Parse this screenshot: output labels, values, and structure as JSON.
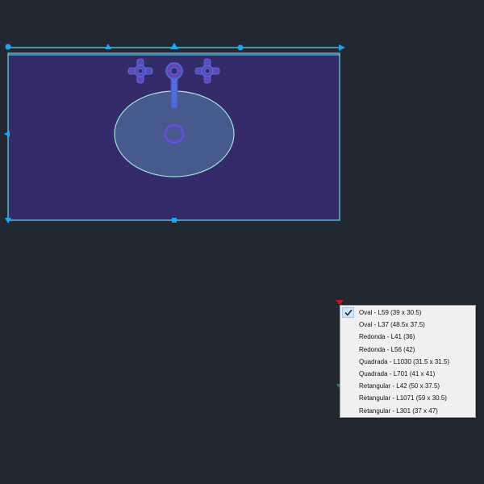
{
  "colors": {
    "background": "#222831",
    "countertop_fill": "#352b6a",
    "outline": "#6ad6e8",
    "grip": "#19a7f2",
    "basin_fill": "#475a8e",
    "fixture": "#6049b9",
    "fixture_stroke": "#4b6ed8",
    "drag_arrow": "#c0161b"
  },
  "dropdown": {
    "options": [
      {
        "label": "Oval - L59 (39 x 30.5)",
        "selected": true
      },
      {
        "label": "Oval - L37 (48.5x 37.5)",
        "selected": false
      },
      {
        "label": "Redonda - L41 (36)",
        "selected": false
      },
      {
        "label": "Redonda - L56 (42)",
        "selected": false
      },
      {
        "label": "Quadrada - L1030 (31.5 x 31.5)",
        "selected": false
      },
      {
        "label": "Quadrada - L701 (41 x 41)",
        "selected": false
      },
      {
        "label": "Retangular - L42 (50 x 37.5)",
        "selected": false
      },
      {
        "label": "Retangular - L1071 (59 x 30.5)",
        "selected": false
      },
      {
        "label": "Retangular - L301 (37 x 47)",
        "selected": false
      }
    ]
  }
}
